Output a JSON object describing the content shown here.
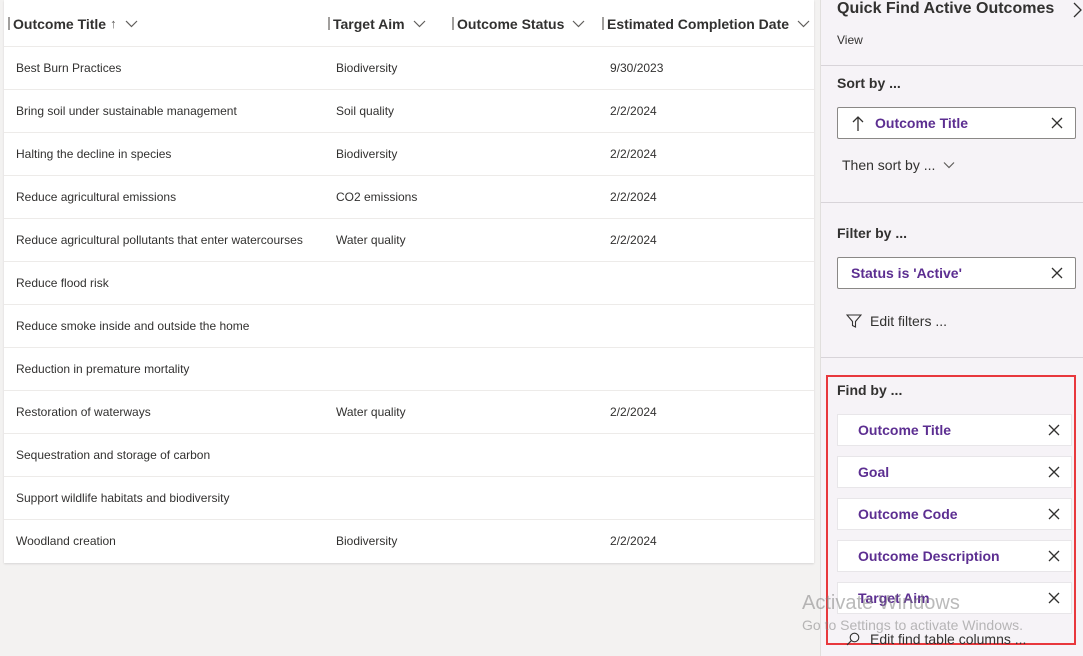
{
  "grid": {
    "columns": [
      {
        "label": "Outcome Title",
        "sort_icon": "↑"
      },
      {
        "label": "Target Aim"
      },
      {
        "label": "Outcome Status"
      },
      {
        "label": "Estimated Completion Date"
      }
    ],
    "rows": [
      {
        "title": "Best Burn Practices",
        "aim": "Biodiversity",
        "status": "",
        "date": "9/30/2023"
      },
      {
        "title": "Bring soil under sustainable management",
        "aim": "Soil quality",
        "status": "",
        "date": "2/2/2024"
      },
      {
        "title": "Halting the decline in species",
        "aim": "Biodiversity",
        "status": "",
        "date": "2/2/2024"
      },
      {
        "title": "Reduce agricultural emissions",
        "aim": "CO2 emissions",
        "status": "",
        "date": "2/2/2024"
      },
      {
        "title": "Reduce agricultural pollutants that enter watercourses",
        "aim": "Water quality",
        "status": "",
        "date": "2/2/2024"
      },
      {
        "title": "Reduce flood risk",
        "aim": "",
        "status": "",
        "date": ""
      },
      {
        "title": "Reduce smoke inside and outside the home",
        "aim": "",
        "status": "",
        "date": ""
      },
      {
        "title": "Reduction in premature mortality",
        "aim": "",
        "status": "",
        "date": ""
      },
      {
        "title": "Restoration of waterways",
        "aim": "Water quality",
        "status": "",
        "date": "2/2/2024"
      },
      {
        "title": "Sequestration and storage of carbon",
        "aim": "",
        "status": "",
        "date": ""
      },
      {
        "title": "Support wildlife habitats and biodiversity",
        "aim": "",
        "status": "",
        "date": ""
      },
      {
        "title": "Woodland creation",
        "aim": "Biodiversity",
        "status": "",
        "date": "2/2/2024"
      }
    ]
  },
  "panel": {
    "title": "Quick Find Active Outcomes",
    "subtitle": "View",
    "sort_label": "Sort by ...",
    "sort_value": "Outcome Title",
    "then_sort_label": "Then sort by ...",
    "filter_label": "Filter by ...",
    "filter_value": "Status is 'Active'",
    "edit_filters_label": "Edit filters ...",
    "find_label": "Find by ...",
    "find_items": [
      "Outcome Title",
      "Goal",
      "Outcome Code",
      "Outcome Description",
      "Target Aim"
    ],
    "edit_find_columns_label": "Edit find table columns ..."
  },
  "watermark": {
    "line1": "Activate Windows",
    "line2": "Go to Settings to activate Windows."
  },
  "colors": {
    "accent": "#5c2e91",
    "highlight_border": "#e8383d"
  },
  "icons": [
    "sort-up-arrow-icon",
    "chevron-down-icon",
    "close-icon",
    "filter-icon",
    "search-icon",
    "chevron-right-icon"
  ]
}
